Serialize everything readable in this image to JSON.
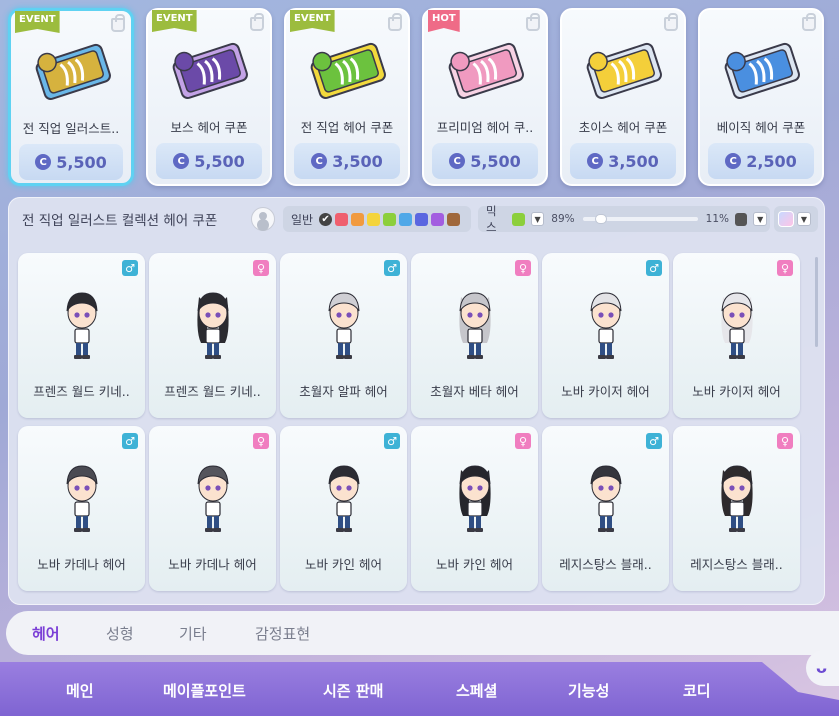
{
  "coupons": [
    {
      "badge": "EVENT",
      "badge_type": "event",
      "name": "전 직업 일러스트..",
      "price": "5,500",
      "selected": true,
      "colors": [
        "#d6b23e",
        "#6ab7e8"
      ]
    },
    {
      "badge": "EVENT",
      "badge_type": "event",
      "name": "보스 헤어 쿠폰",
      "price": "5,500",
      "selected": false,
      "colors": [
        "#6b4aa8",
        "#c3a2e6"
      ]
    },
    {
      "badge": "EVENT",
      "badge_type": "event",
      "name": "전 직업 헤어 쿠폰",
      "price": "3,500",
      "selected": false,
      "colors": [
        "#6cc23e",
        "#f2d93c"
      ]
    },
    {
      "badge": "HOT",
      "badge_type": "hot",
      "name": "프리미엄 헤어 쿠..",
      "price": "5,500",
      "selected": false,
      "colors": [
        "#f09ac0",
        "#f7d2e4"
      ]
    },
    {
      "badge": "",
      "badge_type": "",
      "name": "초이스 헤어 쿠폰",
      "price": "3,500",
      "selected": false,
      "colors": [
        "#f4cf3a",
        "#dde6f2"
      ]
    },
    {
      "badge": "",
      "badge_type": "",
      "name": "베이직 헤어 쿠폰",
      "price": "2,500",
      "selected": false,
      "colors": [
        "#4a8fe0",
        "#dde6f2"
      ]
    }
  ],
  "currency_icon": "C",
  "panel": {
    "title": "전 직업 일러스트 컬렉션 헤어 쿠폰",
    "filter_label": "일반",
    "filter_colors": [
      "#444444",
      "#ef5f6e",
      "#f19a3e",
      "#f4d43c",
      "#8ccf3b",
      "#4fa8e8",
      "#5a66e0",
      "#a35ee0",
      "#a0683c"
    ],
    "mix_label": "믹스",
    "mix_color_a": "#8ccf3b",
    "mix_left_pct": "89%",
    "mix_right_pct": "11%",
    "mix_color_b": "#555555",
    "mix_ratio": 0.89
  },
  "hairs": [
    {
      "name": "프렌즈 월드 키네..",
      "gender": "m",
      "hair": "#2b2b30",
      "long": false
    },
    {
      "name": "프렌즈 월드 키네..",
      "gender": "f",
      "hair": "#2b2b30",
      "long": true
    },
    {
      "name": "초월자 알파 헤어",
      "gender": "m",
      "hair": "#cfcfd4",
      "long": false
    },
    {
      "name": "초월자 베타 헤어",
      "gender": "f",
      "hair": "#c6c6cb",
      "long": true
    },
    {
      "name": "노바 카이저 헤어",
      "gender": "m",
      "hair": "#e3e3e6",
      "long": false
    },
    {
      "name": "노바 카이저 헤어",
      "gender": "f",
      "hair": "#e6e6ea",
      "long": true
    },
    {
      "name": "노바 카데나 헤어",
      "gender": "m",
      "hair": "#4a4a52",
      "long": false
    },
    {
      "name": "노바 카데나 헤어",
      "gender": "f",
      "hair": "#55555c",
      "long": false
    },
    {
      "name": "노바 카인 헤어",
      "gender": "m",
      "hair": "#2c2c33",
      "long": false
    },
    {
      "name": "노바 카인 헤어",
      "gender": "f",
      "hair": "#26262c",
      "long": true
    },
    {
      "name": "레지스탕스 블래..",
      "gender": "m",
      "hair": "#35353c",
      "long": false
    },
    {
      "name": "레지스탕스 블래..",
      "gender": "f",
      "hair": "#2e2a2c",
      "long": true
    }
  ],
  "gender_symbols": {
    "m": "♂",
    "f": "♀"
  },
  "subtabs": [
    "헤어",
    "성형",
    "기타",
    "감정표현"
  ],
  "active_subtab": "헤어",
  "nav": [
    "메인",
    "메이플포인트",
    "시즌 판매",
    "스페셜",
    "기능성",
    "코디"
  ],
  "mascot_icon": "ᵕ‿ᵕ"
}
